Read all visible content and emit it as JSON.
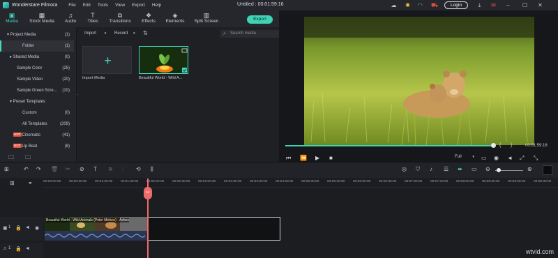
{
  "app": {
    "name": "Wonderstare Filmora",
    "title": "Untitled : 00:01:59:16"
  },
  "menu": [
    "File",
    "Edit",
    "Tools",
    "View",
    "Export",
    "Help"
  ],
  "topbar": {
    "login_label": "Login"
  },
  "tabs": [
    {
      "label": "Media",
      "icon": "media-icon"
    },
    {
      "label": "Stock Media",
      "icon": "stock-media-icon"
    },
    {
      "label": "Audio",
      "icon": "music-icon"
    },
    {
      "label": "Titles",
      "icon": "text-icon"
    },
    {
      "label": "Transitions",
      "icon": "transitions-icon"
    },
    {
      "label": "Effects",
      "icon": "effects-icon"
    },
    {
      "label": "Elements",
      "icon": "elements-icon"
    },
    {
      "label": "Split Screen",
      "icon": "split-screen-icon"
    }
  ],
  "export_label": "Export",
  "sidebar": {
    "items": [
      {
        "label": "Project Media",
        "count": "(1)"
      },
      {
        "label": "Folder",
        "count": "(1)"
      },
      {
        "label": "Shared Media",
        "count": "(0)"
      },
      {
        "label": "Sample Color",
        "count": "(25)"
      },
      {
        "label": "Sample Video",
        "count": "(20)"
      },
      {
        "label": "Sample Green Scre...",
        "count": "(10)"
      },
      {
        "label": "Preset Templates",
        "count": ""
      },
      {
        "label": "Custom",
        "count": "(0)"
      },
      {
        "label": "All Templates",
        "count": "(209)"
      },
      {
        "label": "Cinematic",
        "count": "(41)",
        "badge": "HOT"
      },
      {
        "label": "Up Beat",
        "count": "(8)",
        "badge": "HOT"
      }
    ]
  },
  "media": {
    "import_dropdown": "Import",
    "record_dropdown": "Record",
    "search_placeholder": "Search media",
    "import_caption": "Import Media",
    "clip_caption": "Beautiful World - Wild A..."
  },
  "preview": {
    "time": "00:01:59:16",
    "quality": "Full",
    "bracket_in": "{",
    "bracket_out": "}"
  },
  "timeline": {
    "ruler": [
      "00:00:00:00",
      "00:00:30:00",
      "00:01:00:00",
      "00:01:30:00",
      "00:02:00:00",
      "00:02:30:00",
      "00:03:00:00",
      "00:03:30:00",
      "00:04:00:00",
      "00:04:30:00",
      "00:05:00:00",
      "00:05:30:00",
      "00:06:00:00",
      "00:06:30:00",
      "00:07:00:00",
      "00:07:30:00",
      "00:08:00:00",
      "00:08:30:00",
      "00:09:00:00",
      "00:09:30:00"
    ],
    "clip_label": "Beautiful World - Wild Animals (Peter Minkov) - Ashes",
    "track_video_num": "1",
    "track_audio_num": "1"
  },
  "watermark": "wtvid.com",
  "colors": {
    "accent": "#3fd3b6",
    "playhead": "#ef6a6a",
    "hot_badge": "#e4553d"
  }
}
